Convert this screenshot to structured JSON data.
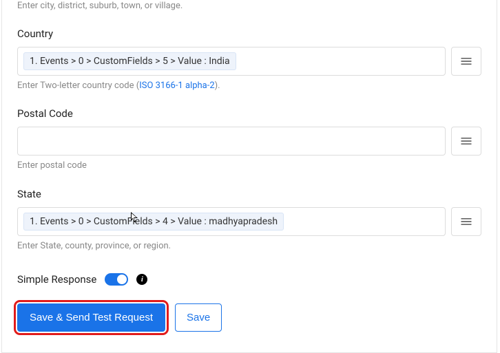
{
  "city_helper": "Enter city, district, suburb, town, or village.",
  "country": {
    "label": "Country",
    "chip": "1. Events > 0 > CustomFields > 5 > Value : India",
    "helper_prefix": "Enter Two-letter country code (",
    "helper_link": "ISO 3166-1 alpha-2",
    "helper_suffix": ")."
  },
  "postal": {
    "label": "Postal Code",
    "helper": "Enter postal code"
  },
  "state": {
    "label": "State",
    "chip": "1. Events > 0 > CustomFields > 4 > Value : madhyapradesh",
    "helper": "Enter State, county, province, or region."
  },
  "simple_response_label": "Simple Response",
  "buttons": {
    "primary": "Save & Send Test Request",
    "secondary": "Save"
  }
}
